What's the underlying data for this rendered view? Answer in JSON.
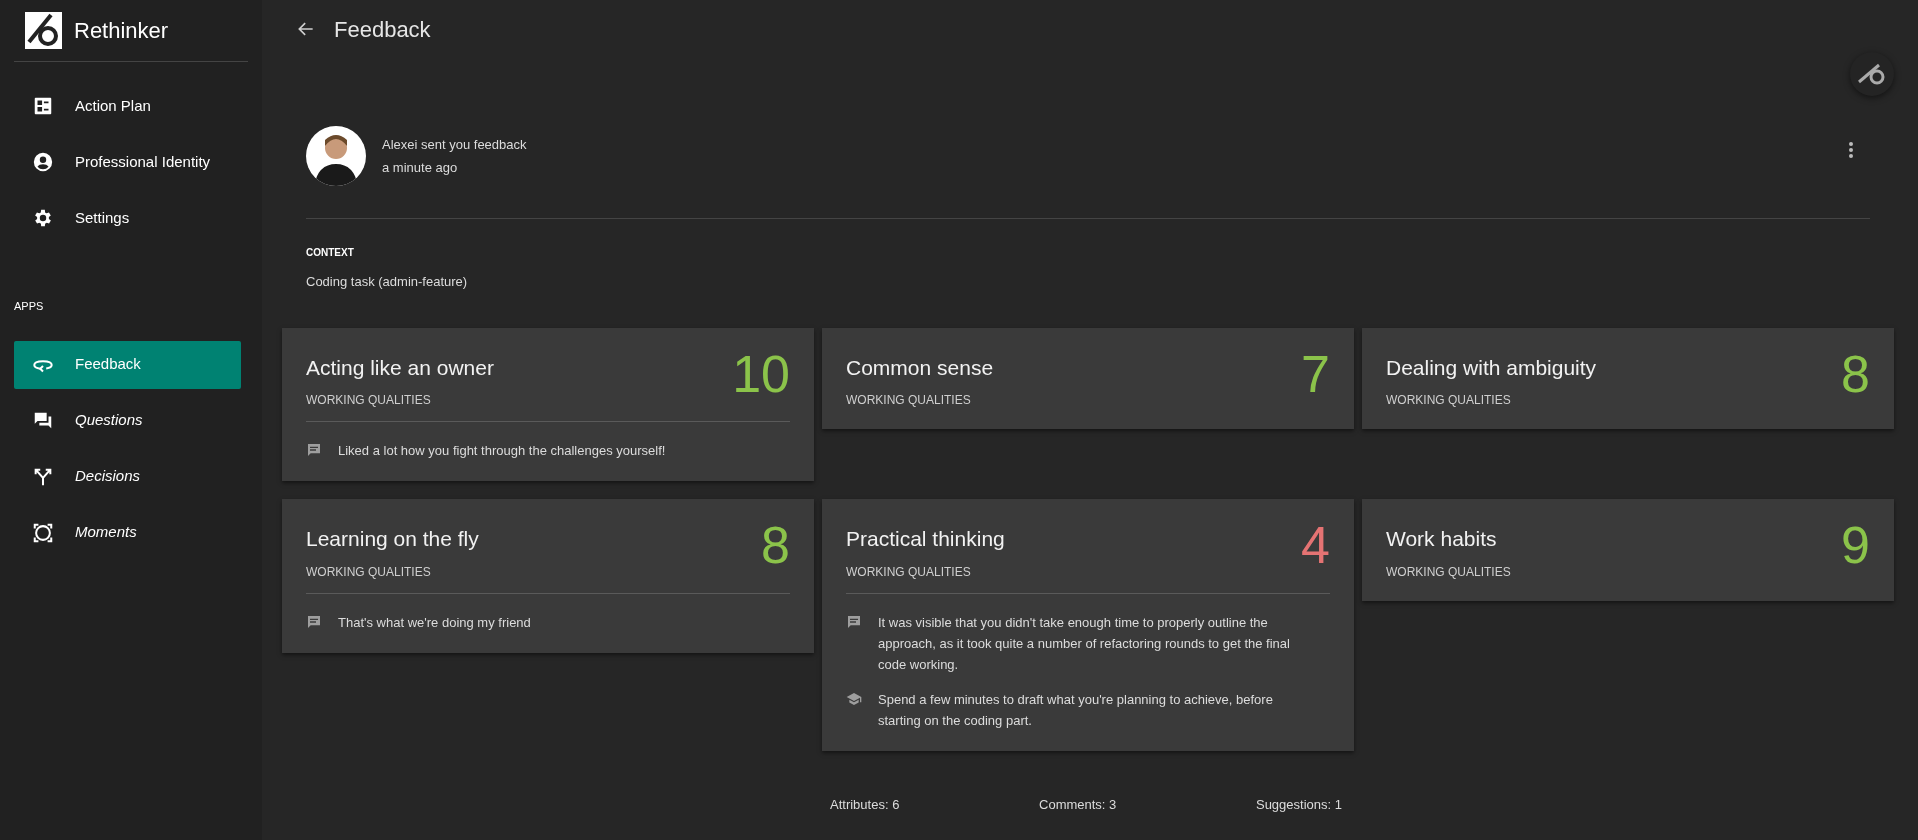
{
  "sidebar": {
    "brand": "Rethinker",
    "items": [
      {
        "label": "Action Plan",
        "selected": false,
        "disabled": false
      },
      {
        "label": "Professional Identity",
        "selected": false,
        "disabled": false
      },
      {
        "label": "Settings",
        "selected": false,
        "disabled": false
      }
    ],
    "section": "APPS",
    "apps": [
      {
        "label": "Feedback",
        "selected": true,
        "disabled": false
      },
      {
        "label": "Questions",
        "selected": false,
        "disabled": true
      },
      {
        "label": "Decisions",
        "selected": false,
        "disabled": true
      },
      {
        "label": "Moments",
        "selected": false,
        "disabled": true
      }
    ]
  },
  "header": {
    "title": "Feedback"
  },
  "feedback": {
    "sender": "Alexei sent you feedback",
    "time": "a minute ago",
    "context_label": "CONTEXT",
    "context": "Coding task (admin-feature)",
    "cards": [
      {
        "title": "Acting like an owner",
        "category": "WORKING QUALITIES",
        "score": "10",
        "color": "#8bc34a",
        "notes": [
          {
            "kind": "comment",
            "text": "Liked a lot how you fight through the challenges yourself!"
          }
        ]
      },
      {
        "title": "Common sense",
        "category": "WORKING QUALITIES",
        "score": "7",
        "color": "#8bc34a"
      },
      {
        "title": "Dealing with ambiguity",
        "category": "WORKING QUALITIES",
        "score": "8",
        "color": "#8bc34a"
      },
      {
        "title": "Learning on the fly",
        "category": "WORKING QUALITIES",
        "score": "8",
        "color": "#8bc34a",
        "notes": [
          {
            "kind": "comment",
            "text": "That's what we're doing my friend"
          }
        ]
      },
      {
        "title": "Practical thinking",
        "category": "WORKING QUALITIES",
        "score": "4",
        "color": "#e57373",
        "notes": [
          {
            "kind": "comment",
            "text": "It was visible that you didn't take enough time to properly outline the approach, as it took quite a number of refactoring rounds to get the final code working."
          },
          {
            "kind": "suggestion",
            "text": "Spend a few minutes to draft what you're planning to achieve, before starting on the coding part."
          }
        ]
      },
      {
        "title": "Work habits",
        "category": "WORKING QUALITIES",
        "score": "9",
        "color": "#8bc34a"
      }
    ],
    "stats": [
      "Attributes: 6",
      "Comments: 3",
      "Suggestions: 1"
    ]
  }
}
